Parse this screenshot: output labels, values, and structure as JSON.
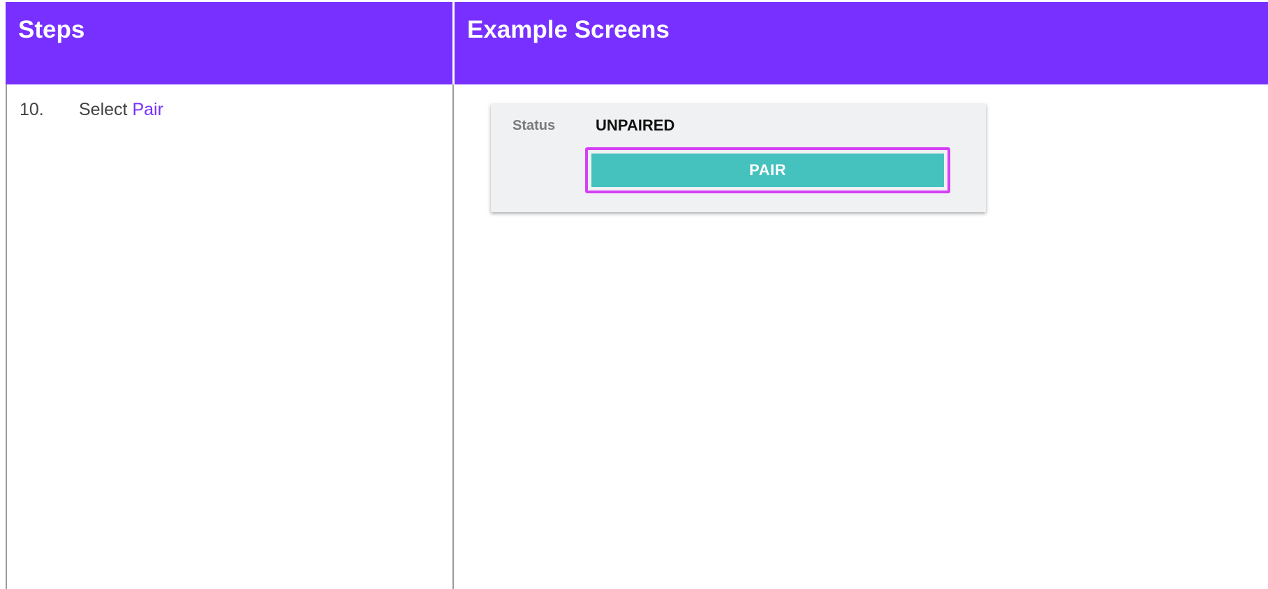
{
  "table": {
    "headers": {
      "steps": "Steps",
      "screens": "Example Screens"
    },
    "step": {
      "number": "10.",
      "text": "Select ",
      "highlight": "Pair"
    }
  },
  "screen": {
    "status_label": "Status",
    "status_value": "UNPAIRED",
    "pair_button_label": "PAIR"
  },
  "colors": {
    "header_bg": "#7730ff",
    "highlight_text": "#7730ff",
    "pair_button": "#46c2be",
    "callout_outline": "#d640f5"
  }
}
